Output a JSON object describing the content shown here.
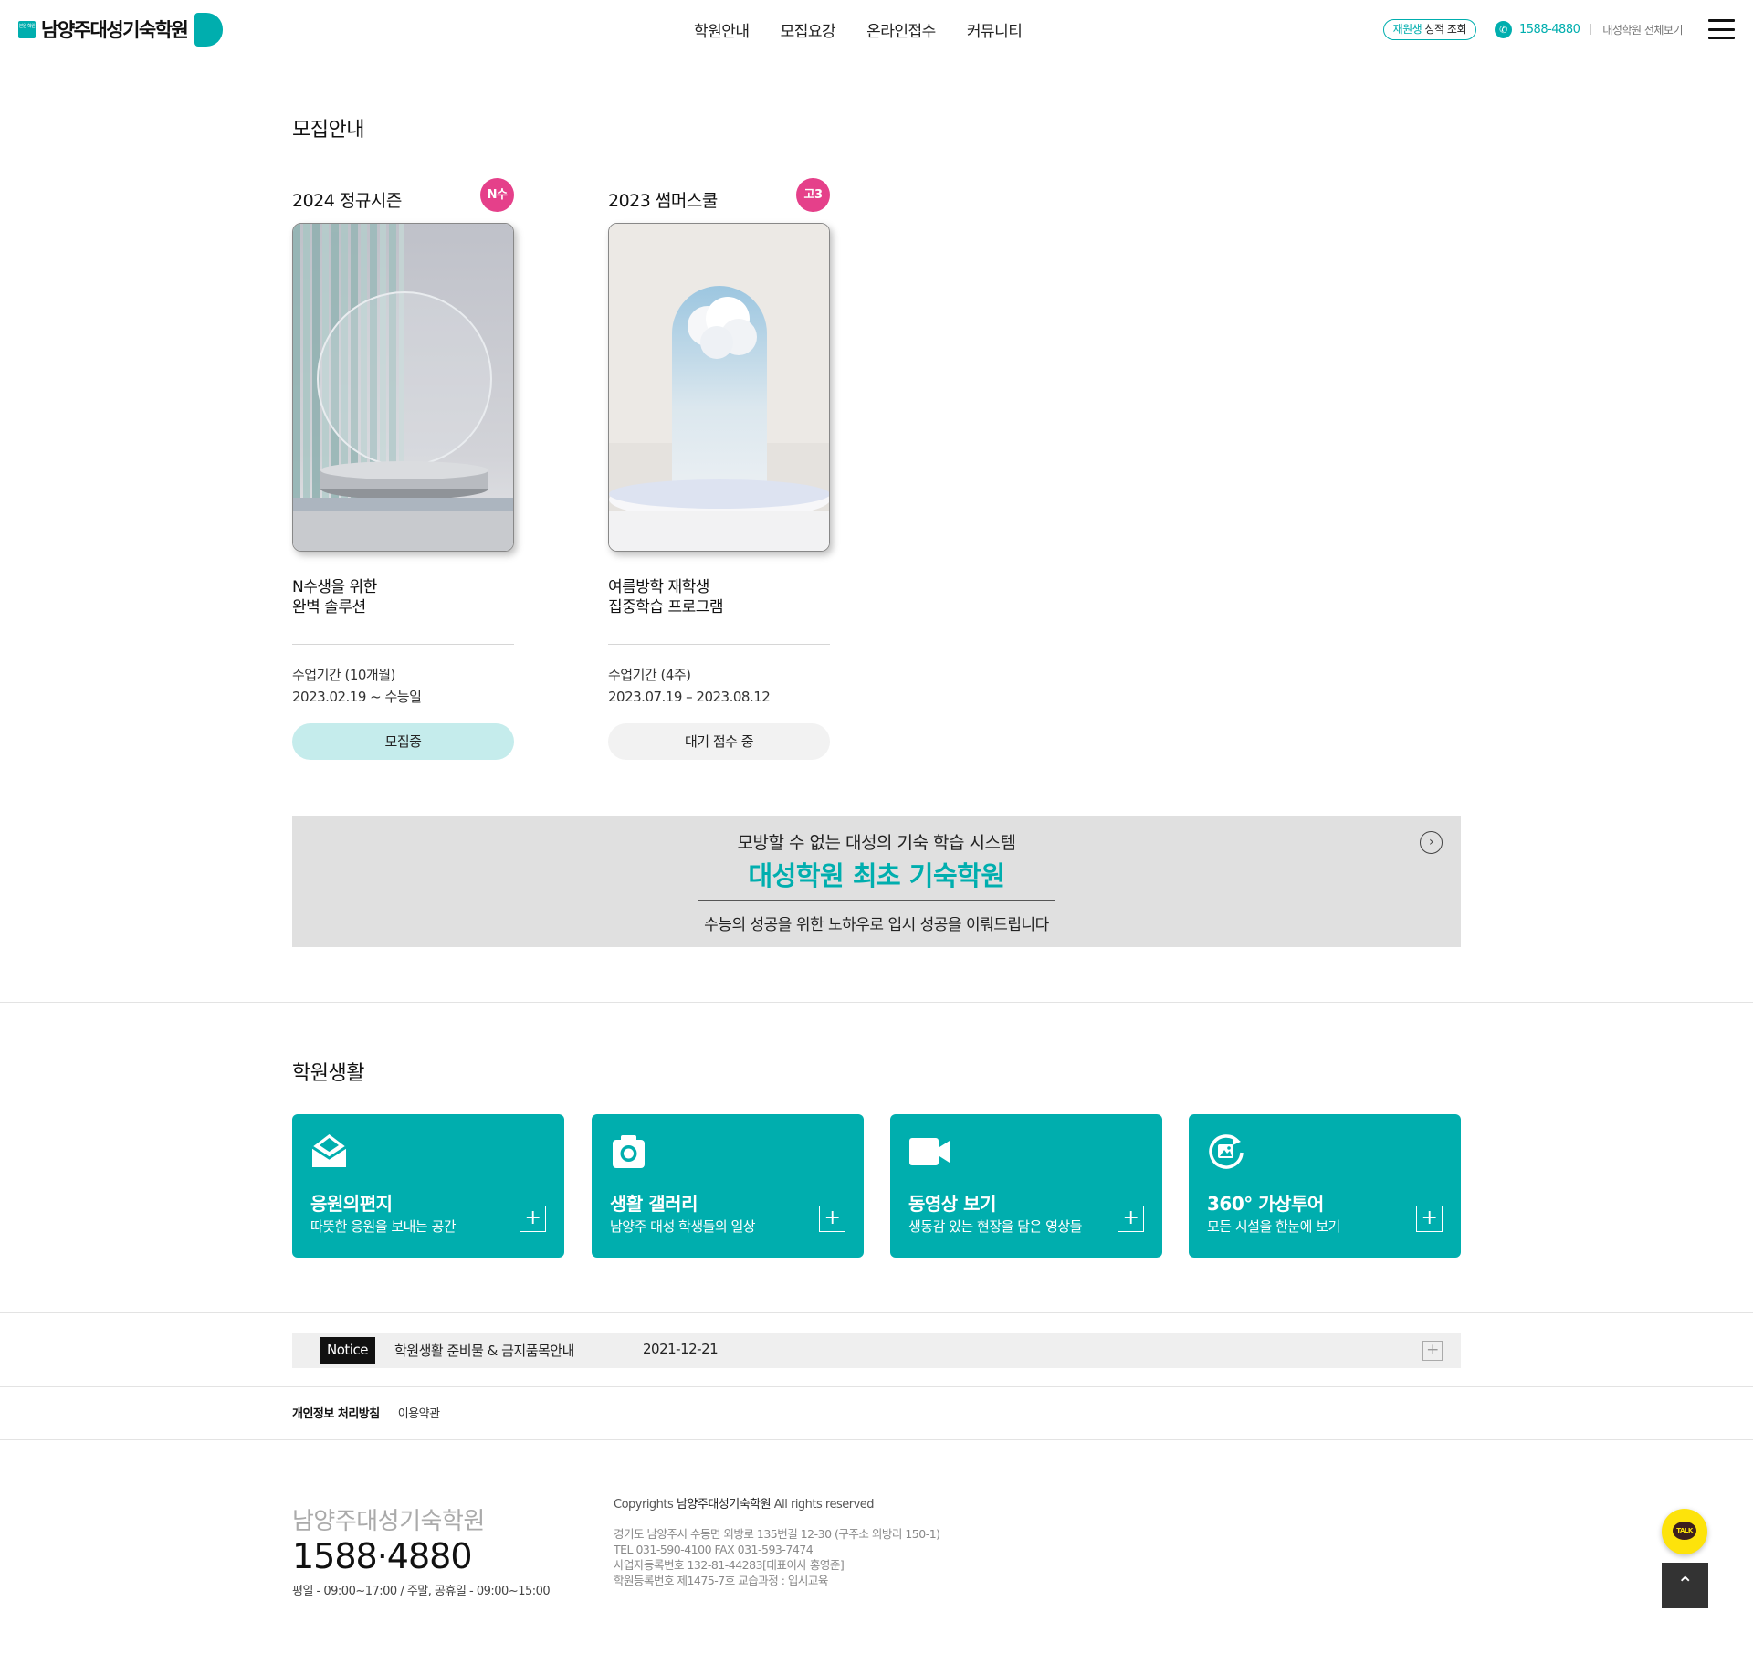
{
  "header": {
    "logo_mark": "본원 학원",
    "logo_text": "남양주대성기숙학원",
    "nav": [
      "학원안내",
      "모집요강",
      "온라인접수",
      "커뮤니티"
    ],
    "score_accent": "재원생",
    "score_rest": "성적 조회",
    "phone": "1588-4880",
    "all_view": "대성학원 전체보기"
  },
  "recruit": {
    "title": "모집안내",
    "cards": [
      {
        "title": "2024 정규시즌",
        "badge": "N수",
        "desc_line1": "N수생을 위한",
        "desc_line2": "완벽 솔루션",
        "period_label": "수업기간 (10개월)",
        "period_dates": "2023.02.19 ~ 수능일",
        "status": "모집중"
      },
      {
        "title": "2023 썸머스쿨",
        "badge": "고3",
        "desc_line1": "여름방학 재학생",
        "desc_line2": "집중학습 프로그램",
        "period_label": "수업기간 (4주)",
        "period_dates": "2023.07.19 – 2023.08.12",
        "status": "대기 접수 중"
      }
    ]
  },
  "banner": {
    "sub": "모방할 수 없는 대성의 기숙 학습 시스템",
    "main": "대성학원 최초 기숙학원",
    "foot": "수능의 성공을 위한 노하우로 입시 성공을 이뤄드립니다"
  },
  "life": {
    "title": "학원생활",
    "tiles": [
      {
        "title": "응원의편지",
        "desc": "따뜻한 응원을 보내는 공간",
        "icon": "envelope-icon"
      },
      {
        "title": "생활 갤러리",
        "desc": "남양주 대성 학생들의 일상",
        "icon": "camera-icon"
      },
      {
        "title": "동영상 보기",
        "desc": "생동감 있는 현장을 담은 영상들",
        "icon": "video-camera-icon"
      },
      {
        "title": "360° 가상투어",
        "desc": "모든 시설을 한눈에 보기",
        "icon": "360-tour-icon"
      }
    ]
  },
  "notice": {
    "tag": "Notice",
    "text": "학원생활 준비물 & 금지품목안내",
    "date": "2021-12-21"
  },
  "policy": {
    "privacy": "개인정보 처리방침",
    "terms": "이용약관"
  },
  "footer": {
    "name": "남양주대성기숙학원",
    "phone": "1588·4880",
    "hours": "평일 - 09:00~17:00 / 주말, 공휴일 - 09:00~15:00",
    "copy_pre": "Copyrights",
    "copy_name": "남양주대성기숙학원",
    "copy_post": "All rights reserved",
    "addr1": "경기도 남양주시 수동면 외방로 135번길 12-30 (구주소 외방리 150-1)",
    "addr2": "TEL 031-590-4100 FAX 031-593-7474",
    "addr3": "사업자등록번호 132-81-44283[대표이사 홍영준]",
    "addr4": "학원등록번호 제1475-7호 교습과정 : 입시교육",
    "kakao": "TALK"
  },
  "colors": {
    "accent": "#00aeae",
    "badge": "#e5408a",
    "status_on": "#c5ecec",
    "status_off": "#f2f2f2"
  }
}
